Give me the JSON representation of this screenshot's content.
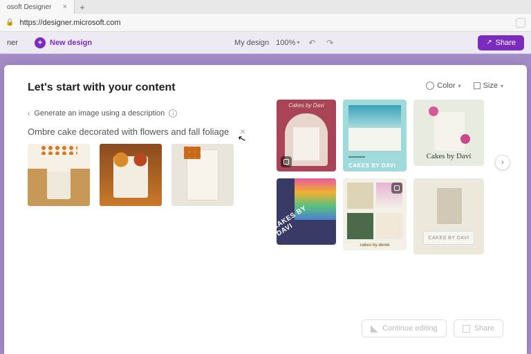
{
  "browser": {
    "tab_title": "osoft Designer",
    "url": "https://designer.microsoft.com"
  },
  "header": {
    "app_name_fragment": "ner",
    "new_design": "New design",
    "doc_name": "My design",
    "zoom": "100%",
    "share": "Share"
  },
  "main": {
    "title": "Let's start with your content",
    "generate_label": "Generate an image using a description",
    "prompt": "Ombre cake decorated with flowers and fall foliage"
  },
  "controls": {
    "color": "Color",
    "size": "Size"
  },
  "templates": [
    {
      "label": "Cakes by Davi"
    },
    {
      "label": "CAKES BY DAVI"
    },
    {
      "label": "Cakes by Davi"
    },
    {
      "label": "CAKES BY DAVI"
    },
    {
      "label": "cakes by derek"
    },
    {
      "label": "CAKES BY DAVI"
    }
  ],
  "actions": {
    "continue": "Continue editing",
    "share": "Share"
  }
}
